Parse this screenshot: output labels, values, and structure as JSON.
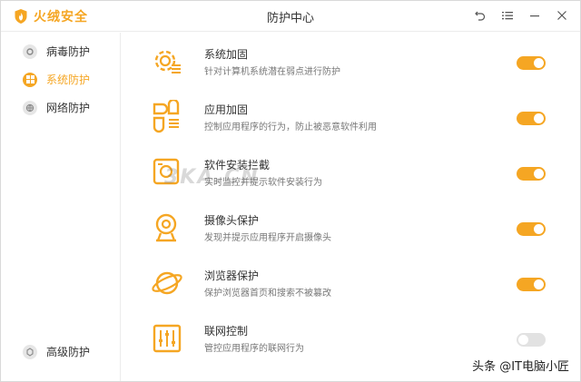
{
  "app": {
    "name": "火绒安全",
    "window_title": "防护中心"
  },
  "sidebar": {
    "items": [
      {
        "label": "病毒防护",
        "active": false
      },
      {
        "label": "系统防护",
        "active": true
      },
      {
        "label": "网络防护",
        "active": false
      }
    ],
    "bottom_item": {
      "label": "高级防护"
    }
  },
  "features": [
    {
      "title": "系统加固",
      "desc": "针对计算机系统潜在弱点进行防护",
      "icon": "gear-shield-icon",
      "enabled": true
    },
    {
      "title": "应用加固",
      "desc": "控制应用程序的行为，防止被恶意软件利用",
      "icon": "apps-icon",
      "enabled": true
    },
    {
      "title": "软件安装拦截",
      "desc": "实时监控并提示软件安装行为",
      "icon": "install-block-icon",
      "enabled": true
    },
    {
      "title": "摄像头保护",
      "desc": "发现并提示应用程序开启摄像头",
      "icon": "webcam-icon",
      "enabled": true
    },
    {
      "title": "浏览器保护",
      "desc": "保护浏览器首页和搜索不被篡改",
      "icon": "browser-planet-icon",
      "enabled": true
    },
    {
      "title": "联网控制",
      "desc": "管控应用程序的联网行为",
      "icon": "network-control-icon",
      "enabled": false
    }
  ],
  "colors": {
    "accent": "#f5a623",
    "toggle_off": "#e2e2e2"
  },
  "watermarks": {
    "center": "3KA.CN",
    "corner": "头条 @IT电脑小匠"
  }
}
